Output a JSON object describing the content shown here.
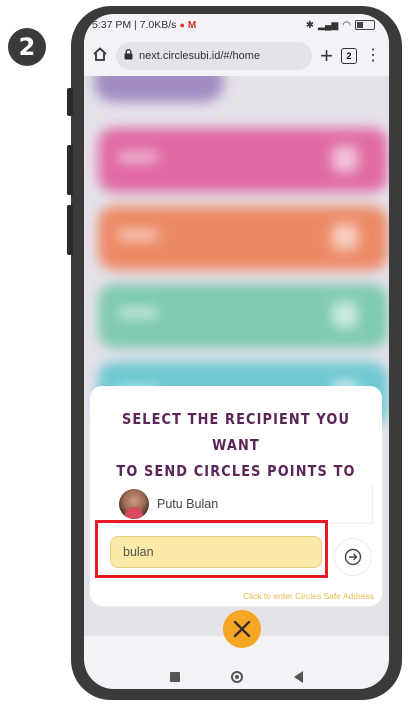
{
  "step_number": "2",
  "status_bar": {
    "time_network": "5:37 PM | 7.0KB/s",
    "battery": "23"
  },
  "browser": {
    "url": "next.circlesubi.id/#/home",
    "tabs_count": "2"
  },
  "dialog": {
    "title_line1": "SELECT THE RECIPIENT YOU WANT",
    "title_line2": "TO SEND CIRCLES POINTS TO",
    "recipient_name": "Putu Bulan",
    "search_value": "bulan",
    "hint_link": "Click to enter Circles Safe Address"
  },
  "colors": {
    "title": "#5a2557",
    "input_bg": "#fbeaa6",
    "highlight": "#e51b24",
    "close_fab": "#f5a623",
    "hint": "#e7b94a"
  },
  "icons": {
    "home": "home-icon",
    "lock": "lock-icon",
    "new_tab": "plus-icon",
    "menu": "kebab-icon",
    "go": "arrow-right-circle-icon",
    "close": "close-icon"
  }
}
